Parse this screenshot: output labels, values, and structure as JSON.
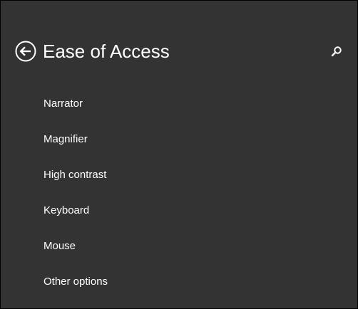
{
  "header": {
    "title": "Ease of Access",
    "back_icon": "back-arrow-icon",
    "search_icon": "search-icon"
  },
  "menu": {
    "items": [
      {
        "label": "Narrator"
      },
      {
        "label": "Magnifier"
      },
      {
        "label": "High contrast"
      },
      {
        "label": "Keyboard"
      },
      {
        "label": "Mouse"
      },
      {
        "label": "Other options"
      }
    ]
  },
  "colors": {
    "background": "#333333",
    "text": "#ffffff",
    "border": "#000000"
  }
}
